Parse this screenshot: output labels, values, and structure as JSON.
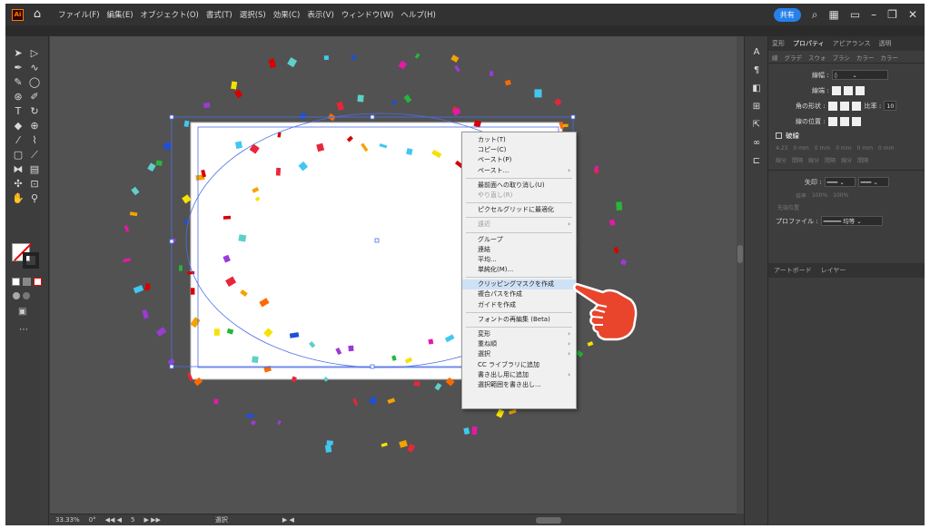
{
  "menubar": {
    "app_badge": "Ai",
    "items": [
      "ファイル(F)",
      "編集(E)",
      "オブジェクト(O)",
      "書式(T)",
      "選択(S)",
      "効果(C)",
      "表示(V)",
      "ウィンドウ(W)",
      "ヘルプ(H)"
    ],
    "share_label": "共有"
  },
  "context_menu": {
    "items": [
      {
        "label": "カット(T)",
        "state": "normal"
      },
      {
        "label": "コピー(C)",
        "state": "normal"
      },
      {
        "label": "ペースト(P)",
        "state": "normal"
      },
      {
        "label": "ペースト...",
        "state": "normal",
        "submenu": true
      },
      {
        "sep": true
      },
      {
        "label": "最前面への取り消し(U)",
        "state": "normal"
      },
      {
        "label": "やり直し(R)",
        "state": "disabled"
      },
      {
        "sep": true
      },
      {
        "label": "ピクセルグリッドに最適化",
        "state": "normal"
      },
      {
        "sep": true
      },
      {
        "label": "遠近",
        "state": "disabled",
        "submenu": true
      },
      {
        "sep": true
      },
      {
        "label": "グループ",
        "state": "normal"
      },
      {
        "label": "連結",
        "state": "normal"
      },
      {
        "label": "平均...",
        "state": "normal"
      },
      {
        "label": "単純化(M)...",
        "state": "normal"
      },
      {
        "sep": true
      },
      {
        "label": "クリッピングマスクを作成",
        "state": "highlight"
      },
      {
        "label": "複合パスを作成",
        "state": "normal"
      },
      {
        "label": "ガイドを作成",
        "state": "normal"
      },
      {
        "sep": true
      },
      {
        "label": "フォントの再編集 (Beta)",
        "state": "normal"
      },
      {
        "sep": true
      },
      {
        "label": "変形",
        "state": "normal",
        "submenu": true
      },
      {
        "label": "重ね順",
        "state": "normal",
        "submenu": true
      },
      {
        "label": "選択",
        "state": "normal",
        "submenu": true
      },
      {
        "label": "CC ライブラリに追加",
        "state": "normal"
      },
      {
        "label": "書き出し用に追加",
        "state": "normal",
        "submenu": true
      },
      {
        "label": "選択範囲を書き出し...",
        "state": "normal"
      }
    ]
  },
  "panel": {
    "tabs": [
      "変形",
      "プロパティ",
      "アピアランス",
      "透明"
    ],
    "active_tab": "プロパティ",
    "subtabs": [
      "線",
      "グラデ",
      "スウォ",
      "ブラシ",
      "カラー",
      "カラー"
    ],
    "stroke_width_label": "線幅 :",
    "cap_label": "線端 :",
    "corner_label": "角の形状 :",
    "ratio_label": "比率 :",
    "ratio_value": "10",
    "align_label": "線の位置 :",
    "dash_label": "破線",
    "dash_fields": [
      "4.23",
      "0 mm",
      "0 mm",
      "0 mm",
      "0 mm",
      "0 mm"
    ],
    "dash_subfields": [
      "線分",
      "間隔",
      "線分",
      "間隔",
      "線分",
      "間隔"
    ],
    "arrow_label": "矢印 :",
    "scale_label": "倍率",
    "scale_value_1": "100%",
    "scale_value_2": "100%",
    "align_arrow_label": "先端位置",
    "profile_label": "プロファイル :",
    "profile_value": "均等",
    "bottom_tabs": [
      "アートボード",
      "レイヤー"
    ]
  },
  "status": {
    "zoom": "33.33%",
    "rotation": "0°",
    "artboard_num": "5",
    "tool": "選択"
  },
  "colors": {
    "accent": "#2680eb",
    "menu_highlight": "#cfe1f5",
    "hand_fill": "#e8452c"
  }
}
